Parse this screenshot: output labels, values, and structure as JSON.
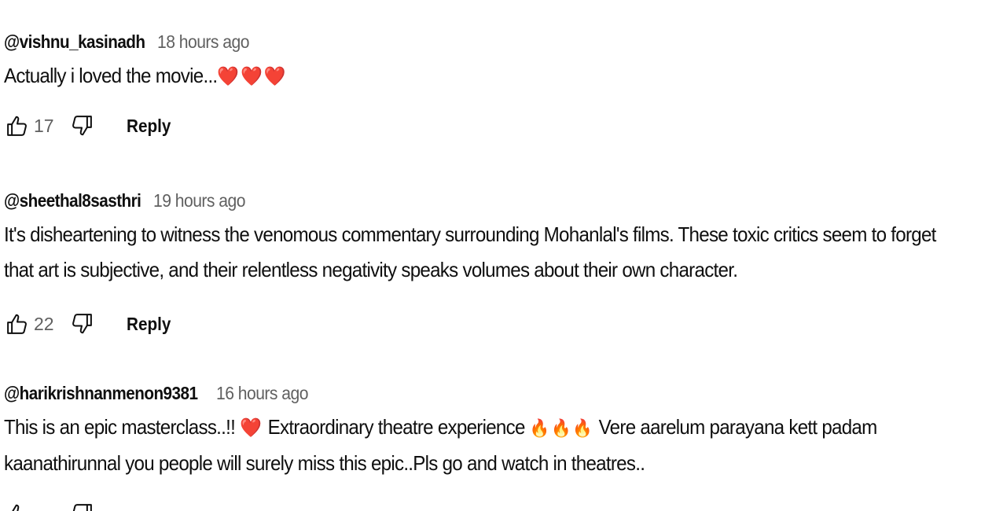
{
  "comments": [
    {
      "author": "@vishnu_kasinadh",
      "time": "18 hours ago",
      "text": "Actually i loved the movie...",
      "emoji": "❤️❤️❤️",
      "likes": "17",
      "reply_label": "Reply"
    },
    {
      "author": "@sheethal8sasthri",
      "time": "19 hours ago",
      "text_line1": "It's disheartening to witness the venomous commentary surrounding Mohanlal's films. These toxic critics seem to forget",
      "text_line2": "that art is subjective, and their relentless negativity speaks volumes about their own character.",
      "likes": "22",
      "reply_label": "Reply"
    },
    {
      "author": "@harikrishnanmenon9381",
      "time": "16 hours ago",
      "text_part1": "This is an epic masterclass..!! ",
      "heart": "❤️",
      "text_part2": " Extraordinary theatre experience ",
      "fire": "🔥🔥🔥",
      "text_part3": " Vere aarelum parayana kett padam",
      "text_line2": "kaanathirunnal you people will surely miss this epic..Pls go and watch in theatres.."
    }
  ],
  "colors": {
    "text": "#0f0f0f",
    "secondary": "#606060",
    "heart": "#e0242b",
    "fire": "#f07a18"
  },
  "icons": [
    "thumbs-up-icon",
    "thumbs-down-icon"
  ]
}
